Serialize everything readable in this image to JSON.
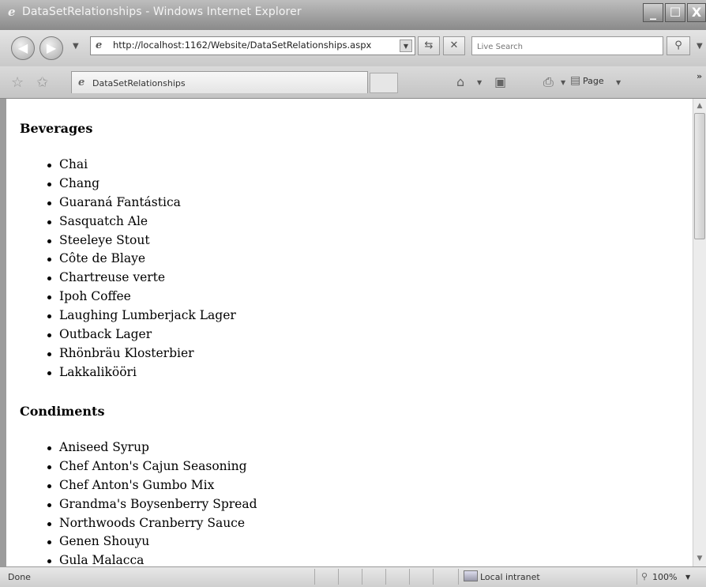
{
  "window": {
    "title": "DataSetRelationships - Windows Internet Explorer",
    "controls": [
      "_",
      "☐",
      "X"
    ]
  },
  "address_bar": {
    "url": "http://localhost:1162/Website/DataSetRelationships.aspx",
    "search_placeholder": "Live Search"
  },
  "tab": {
    "label": "DataSetRelationships"
  },
  "commandbar": {
    "page_label": "Page"
  },
  "content": {
    "categories": [
      {
        "name": "Beverages",
        "products": [
          "Chai",
          "Chang",
          "Guaraná Fantástica",
          "Sasquatch Ale",
          "Steeleye Stout",
          "Côte de Blaye",
          "Chartreuse verte",
          "Ipoh Coffee",
          "Laughing Lumberjack Lager",
          "Outback Lager",
          "Rhönbräu Klosterbier",
          "Lakkalikööri"
        ]
      },
      {
        "name": "Condiments",
        "products": [
          "Aniseed Syrup",
          "Chef Anton's Cajun Seasoning",
          "Chef Anton's Gumbo Mix",
          "Grandma's Boysenberry Spread",
          "Northwoods Cranberry Sauce",
          "Genen Shouyu",
          "Gula Malacca"
        ]
      }
    ]
  },
  "statusbar": {
    "status": "Done",
    "zone": "Local intranet",
    "zoom": "100%"
  }
}
